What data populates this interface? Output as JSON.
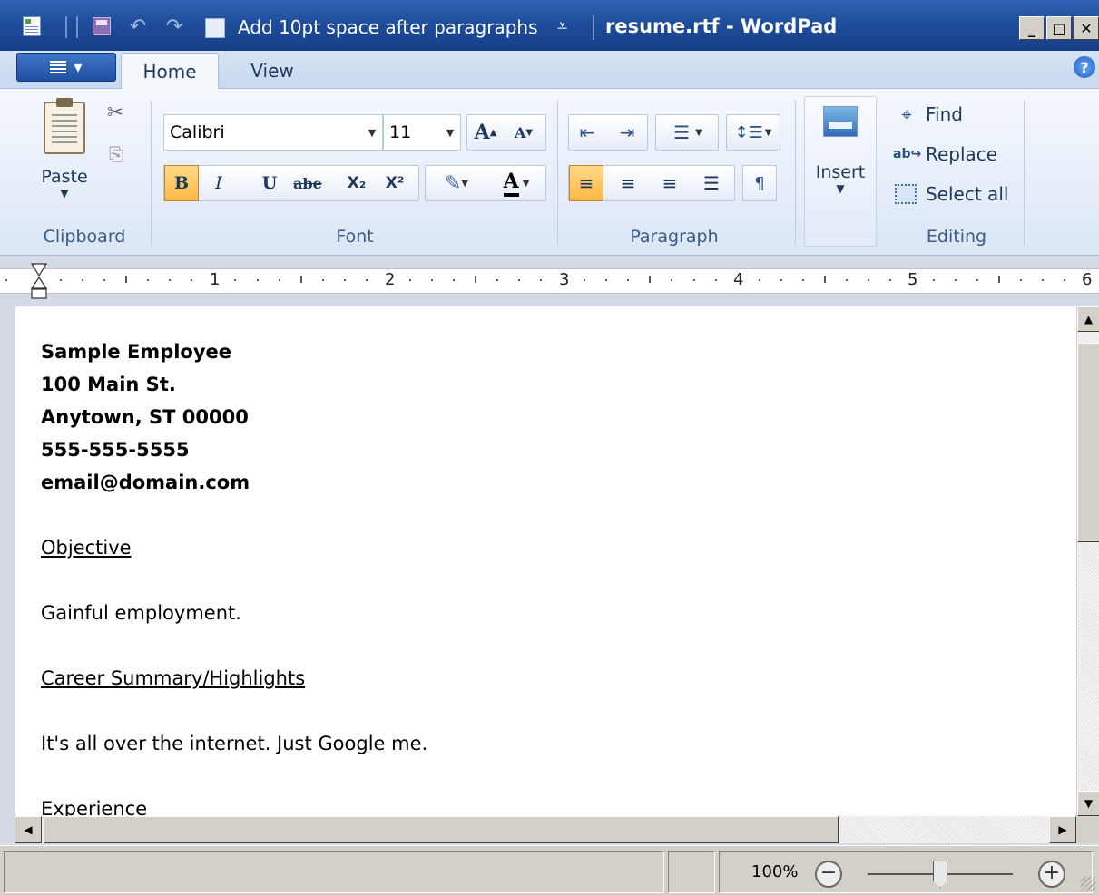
{
  "window": {
    "title": "resume.rtf - WordPad",
    "qat_label": "Add 10pt space after paragraphs",
    "caption": {
      "minimize": "_",
      "maximize": "□",
      "close": "✕"
    }
  },
  "tabs": {
    "home": "Home",
    "view": "View"
  },
  "ribbon": {
    "clipboard": {
      "paste": "Paste",
      "group_label": "Clipboard"
    },
    "font": {
      "family": "Calibri",
      "size": "11",
      "group_label": "Font",
      "bold": "B",
      "italic": "I",
      "underline": "U",
      "strike": "abe",
      "subscript": "X₂",
      "superscript": "X²",
      "grow": "A",
      "shrink": "A",
      "color_letter": "A"
    },
    "paragraph": {
      "group_label": "Paragraph"
    },
    "insert": {
      "label": "Insert"
    },
    "editing": {
      "find": "Find",
      "replace": "Replace",
      "select_all": "Select all",
      "group_label": "Editing"
    }
  },
  "ruler": {
    "numbers": [
      "1",
      "2",
      "3",
      "4",
      "5",
      "6"
    ]
  },
  "document": {
    "lines": [
      {
        "text": "Sample Employee",
        "style": "bold"
      },
      {
        "text": "100 Main St.",
        "style": "bold"
      },
      {
        "text": "Anytown, ST 00000",
        "style": "bold"
      },
      {
        "text": "555-555-5555",
        "style": "bold"
      },
      {
        "text": "email@domain.com",
        "style": "bold"
      },
      {
        "text": "",
        "style": "blank"
      },
      {
        "text": "Objective",
        "style": "underline"
      },
      {
        "text": "",
        "style": "blank"
      },
      {
        "text": "Gainful employment.",
        "style": "normal"
      },
      {
        "text": "",
        "style": "blank"
      },
      {
        "text": "Career Summary/Highlights",
        "style": "underline"
      },
      {
        "text": "",
        "style": "blank"
      },
      {
        "text": "It's all over the internet.  Just Google me.",
        "style": "normal"
      },
      {
        "text": "",
        "style": "blank"
      },
      {
        "text": "Experience",
        "style": "normal"
      }
    ]
  },
  "status": {
    "zoom": "100%",
    "zoom_fraction": 0.5
  }
}
